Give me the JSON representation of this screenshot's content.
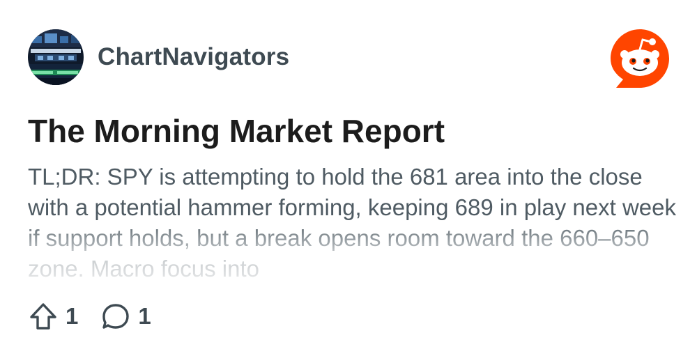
{
  "post": {
    "author": "ChartNavigators",
    "avatar_icon": "stock-exchange-avatar-icon",
    "title": "The Morning Market Report",
    "body": "TL;DR: SPY is attempting to hold the 681 area into the close with a potential hammer forming, keeping 689 in play next week if support holds, but a break opens room toward the 660–650 zone. Macro focus into",
    "upvotes": "1",
    "comments": "1"
  },
  "icons": {
    "brand": "reddit-logo-icon",
    "upvote": "upvote-arrow-icon",
    "comment": "comment-bubble-icon"
  },
  "colors": {
    "brand": "#ff4500",
    "author_text": "#3e4a52",
    "title_text": "#1c1c1c",
    "body_text": "#4f5b63"
  }
}
